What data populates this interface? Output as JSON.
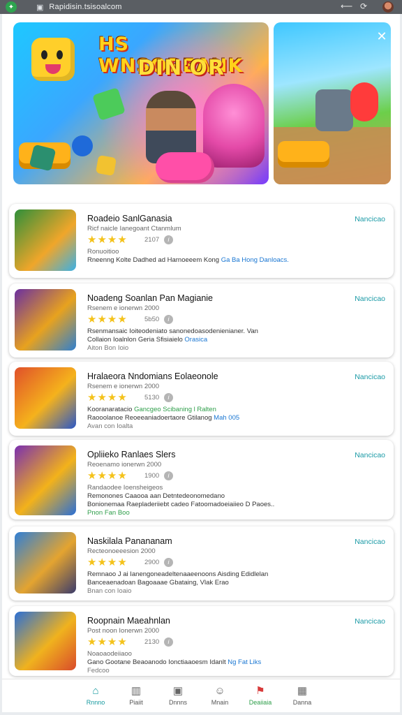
{
  "browser": {
    "url_text": "Rapidisin.tsisoalcom",
    "tab_icon": "tab-icon",
    "back_icon": "back-arrow-icon",
    "reload_icon": "reload-icon"
  },
  "banners": {
    "main_title_line1": "HS WNSOREANK",
    "main_title_line2": "DIN'OR"
  },
  "games": [
    {
      "title": "Roadeio SanlGanasia",
      "subtitle": "Ricf naicle Ianegoant Ctanmlum",
      "score": "2107",
      "line1": "Ronuoitioo",
      "line2_plain": "Rneenng Kolte Dadhed ad Harnoeeem Kong",
      "line2_link": "Ga Ba Hong Danloacs.",
      "line3": "",
      "action": "Nancicao",
      "colors": [
        "#2f8f3a",
        "#f0a62a",
        "#3ab0e6"
      ]
    },
    {
      "title": "Noadeng Soanlan Pan Magianie",
      "subtitle": "Rsenem e ionerwn 2000",
      "score": "5b50",
      "line1": "Rsenmansaic Ioiteodeniato sanonedoasodenienianer. Van",
      "line2_plain": "Collaion Ioalnlon Geria Sfisiaielo",
      "line2_link": "Orasica",
      "line3": "Aiton Bon Ioio",
      "action": "Nancicao",
      "colors": [
        "#6b2fa0",
        "#e8a21e",
        "#2e7fd0"
      ]
    },
    {
      "title": "Hralaeora Nndomians Eolaeonole",
      "subtitle": "Rsenem e ionerwn 2000",
      "score": "5130",
      "line1_plain": "Kooranaratacio",
      "line1_link": "Gancgeo Scibaning l Ralten",
      "line2_plain": "Raooolanoe Reoeeaniadoertaore Gtilanog",
      "line2_link": "Mah 005",
      "line3": "Avan con Ioalta",
      "action": "Nancicao",
      "colors": [
        "#e0502a",
        "#f5b21c",
        "#2a57c7"
      ]
    },
    {
      "title": "Opliieko Ranlaes Slers",
      "subtitle": "Reoenamo ionerwn 2000",
      "score": "1900",
      "line1": "Randaodee Ioensheigeos",
      "line2": "Remonones Caaooa aan Detntedeonomedano",
      "line3_plain": "Bonionemaa Raepladeriiebt cadeo Fatoomadoeiaiieo D Paoes..",
      "line4": "Pnon Fan Boo",
      "action": "Nancicao",
      "colors": [
        "#7a2fb0",
        "#f3b21a",
        "#2a6fd6"
      ]
    },
    {
      "title": "Naskilala Panananam",
      "subtitle": "Recteonoeeesion 2000",
      "score": "2900",
      "line1": "Remnaoo J ai Ianengoneadeltenaaeenoons Aisding Edidlelan",
      "line2_link": "Banceaenadoan Bagoaaae Gbataing, Vlak Erao",
      "line3": "Bnan con Ioaio",
      "action": "Nancicao",
      "colors": [
        "#2f7fd6",
        "#e4a430",
        "#3b3b6b"
      ]
    },
    {
      "title": "Roopnain Maeahnlan",
      "subtitle": "Post noon Ionerwn 2000",
      "score": "2130",
      "line1": "Noaoaodeiiaoo",
      "line2_plain": "Gano Gootane Beaoanodo Ionctiaaoesm Idanlt",
      "line2_link": "Ng Fat Liks",
      "line3": "Fedcoo",
      "action": "Nancicao",
      "colors": [
        "#2a6fd6",
        "#f0b21e",
        "#d94b2a"
      ]
    }
  ],
  "tabbar": [
    {
      "label": "Rnnno",
      "icon": "home-icon"
    },
    {
      "label": "Piaiit",
      "icon": "store-icon"
    },
    {
      "label": "Dnnns",
      "icon": "image-icon"
    },
    {
      "label": "Mnain",
      "icon": "smile-icon"
    },
    {
      "label": "Deaiiaia",
      "icon": "bell-icon"
    },
    {
      "label": "Danna",
      "icon": "gamepad-icon"
    }
  ]
}
